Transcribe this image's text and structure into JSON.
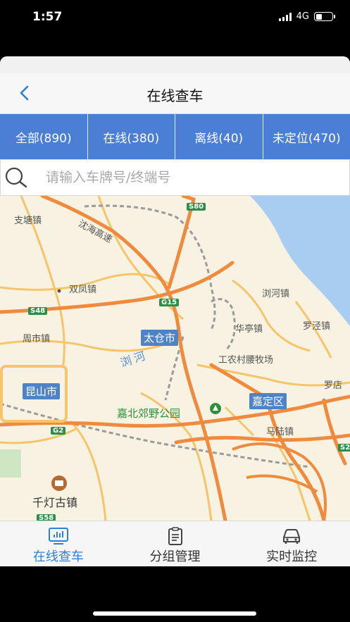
{
  "status_bar": {
    "time": "1:57",
    "network": "4G"
  },
  "header": {
    "title": "在线查车"
  },
  "filter_tabs": [
    {
      "label": "全部(890)"
    },
    {
      "label": "在线(380)"
    },
    {
      "label": "离线(40)"
    },
    {
      "label": "未定位(470)"
    }
  ],
  "search": {
    "placeholder": "请输入车牌号/终端号",
    "value": ""
  },
  "map": {
    "labels": {
      "zhitang": "支塘镇",
      "shuangfeng": "双凤镇",
      "liuhe_town": "浏河镇",
      "huating": "华亭镇",
      "luojing": "罗泾镇",
      "zhoushi": "周市镇",
      "liuhe_river": "浏河",
      "gongnong": "工农村腰牧场",
      "luodian": "罗店",
      "jiabei": "嘉北郊野公园",
      "malu": "马陆镇",
      "qiandeng": "千灯古镇",
      "expressway": "沈海高速"
    },
    "cities": {
      "taicang": "太仓市",
      "kunshan": "昆山市",
      "jiading": "嘉定区"
    },
    "road_badges": {
      "s80": "S80",
      "g15": "G15",
      "s48": "S48",
      "g2": "G2",
      "s58": "S58",
      "s2": "S2"
    }
  },
  "tab_bar": [
    {
      "label": "在线查车",
      "icon": "chart-monitor-icon",
      "active": true
    },
    {
      "label": "分组管理",
      "icon": "clipboard-icon",
      "active": false
    },
    {
      "label": "实时监控",
      "icon": "car-icon",
      "active": false
    }
  ],
  "colors": {
    "accent": "#4b7fd6",
    "active_tab": "#2f7fd6",
    "water": "#a8cdf0",
    "road_major": "#f08a3e",
    "road_minor": "#f6c46a"
  }
}
